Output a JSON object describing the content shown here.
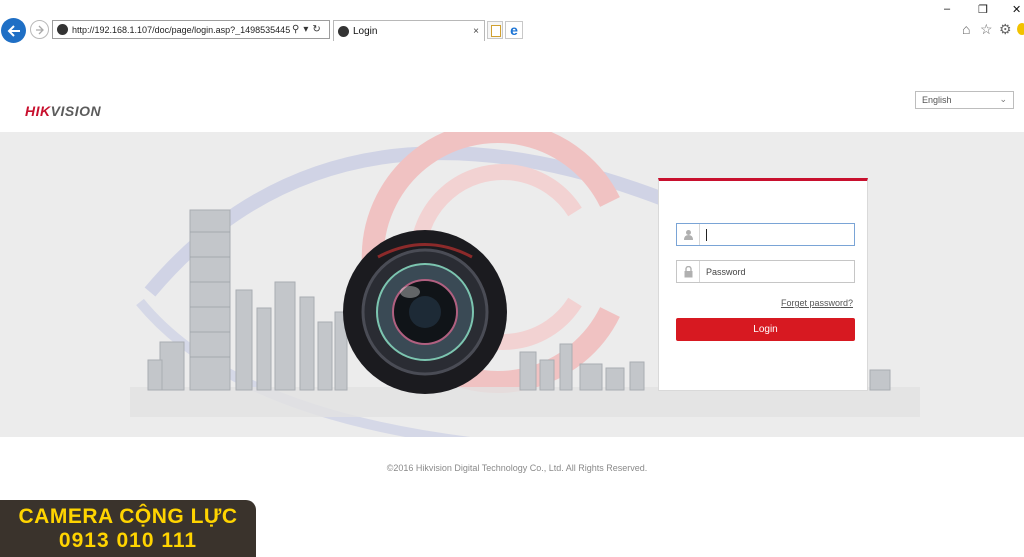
{
  "browser": {
    "address_url": "http://192.168.1.107/doc/page/login.asp?_1498535445",
    "tab_title": "Login",
    "tab_close": "×",
    "search_glyph": "⚲",
    "dropdown_glyph": "▾",
    "refresh_glyph": "↻",
    "window_controls": {
      "minimize": "–",
      "restore": "❐",
      "close": "✕"
    },
    "toolbar_icons": {
      "home": "⌂",
      "favorites": "☆",
      "settings": "⚙"
    }
  },
  "header": {
    "logo_part1": "HIK",
    "logo_part2": "VISION",
    "language": "English"
  },
  "login": {
    "username_value": "",
    "password_placeholder": "Password",
    "forgot_label": "Forget password?",
    "login_label": "Login"
  },
  "footer": {
    "copyright": "©2016 Hikvision Digital Technology Co., Ltd. All Rights Reserved."
  },
  "watermark": {
    "line1": "CAMERA CỘNG LỰC",
    "line2": "0913 010 111"
  },
  "colors": {
    "brand_red": "#c8102e",
    "login_button": "#d71921",
    "browser_blue": "#1f6fc5",
    "watermark_bg": "#3a332c",
    "watermark_text": "#ffd400"
  }
}
